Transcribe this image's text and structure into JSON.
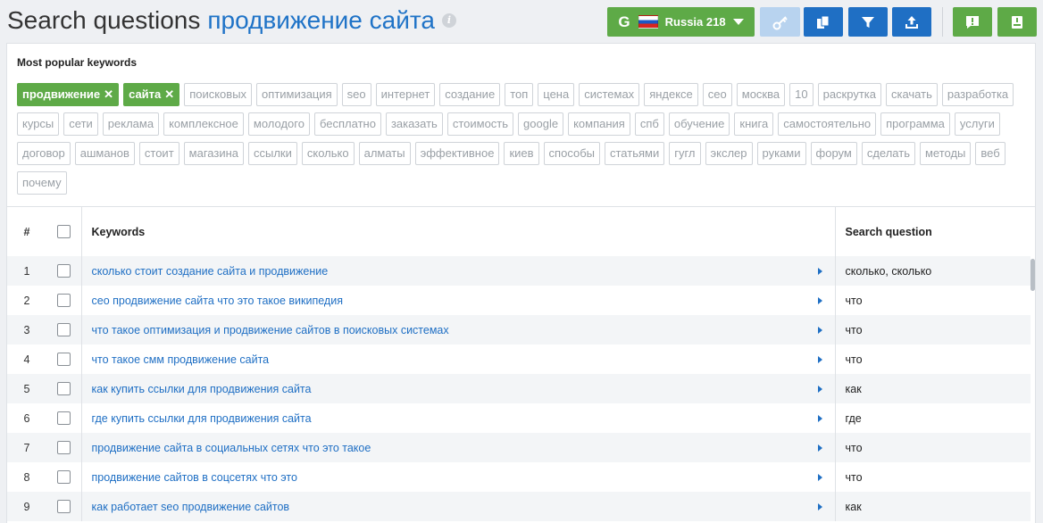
{
  "header": {
    "title_prefix": "Search questions",
    "title_query": "продвижение сайта",
    "info_icon": "i",
    "database": {
      "engine_letter": "G",
      "label": "Russia 218"
    },
    "colors": {
      "green": "#5eaa47",
      "blue": "#1f6fc4",
      "light_blue": "#b8d3ef",
      "link": "#1f73c7"
    }
  },
  "popular": {
    "title": "Most popular keywords",
    "selected_tags": [
      "продвижение",
      "сайта"
    ],
    "remove_glyph": "✕",
    "tags": [
      "поисковых",
      "оптимизация",
      "seo",
      "интернет",
      "создание",
      "топ",
      "цена",
      "системах",
      "яндексе",
      "сео",
      "москва",
      "10",
      "раскрутка",
      "скачать",
      "разработка",
      "курсы",
      "сети",
      "реклама",
      "комплексное",
      "молодого",
      "бесплатно",
      "заказать",
      "стоимость",
      "google",
      "компания",
      "спб",
      "обучение",
      "книга",
      "самостоятельно",
      "программа",
      "услуги",
      "договор",
      "ашманов",
      "стоит",
      "магазина",
      "ссылки",
      "сколько",
      "алматы",
      "эффективное",
      "киев",
      "способы",
      "статьями",
      "гугл",
      "экслер",
      "руками",
      "форум",
      "сделать",
      "методы",
      "веб",
      "почему"
    ]
  },
  "table": {
    "headers": {
      "num": "#",
      "keywords": "Keywords",
      "question": "Search question"
    },
    "rows": [
      {
        "num": "1",
        "keyword": "сколько стоит создание сайта и продвижение",
        "question": "сколько, сколько"
      },
      {
        "num": "2",
        "keyword": "сео продвижение сайта что это такое википедия",
        "question": "что"
      },
      {
        "num": "3",
        "keyword": "что такое оптимизация и продвижение сайтов в поисковых системах",
        "question": "что"
      },
      {
        "num": "4",
        "keyword": "что такое смм продвижение сайта",
        "question": "что"
      },
      {
        "num": "5",
        "keyword": "как купить ссылки для продвижения сайта",
        "question": "как"
      },
      {
        "num": "6",
        "keyword": "где купить ссылки для продвижения сайта",
        "question": "где"
      },
      {
        "num": "7",
        "keyword": "продвижение сайта в социальных сетях что это такое",
        "question": "что"
      },
      {
        "num": "8",
        "keyword": "продвижение сайтов в соцсетях что это",
        "question": "что"
      },
      {
        "num": "9",
        "keyword": "как работает seo продвижение сайтов",
        "question": "как"
      }
    ]
  },
  "icons": {
    "database_dropdown": "chevron-down-icon",
    "key": "key-icon",
    "copy": "copy-icon",
    "filter": "filter-icon",
    "export": "export-icon",
    "feedback": "feedback-icon",
    "guide": "guide-book-icon"
  }
}
